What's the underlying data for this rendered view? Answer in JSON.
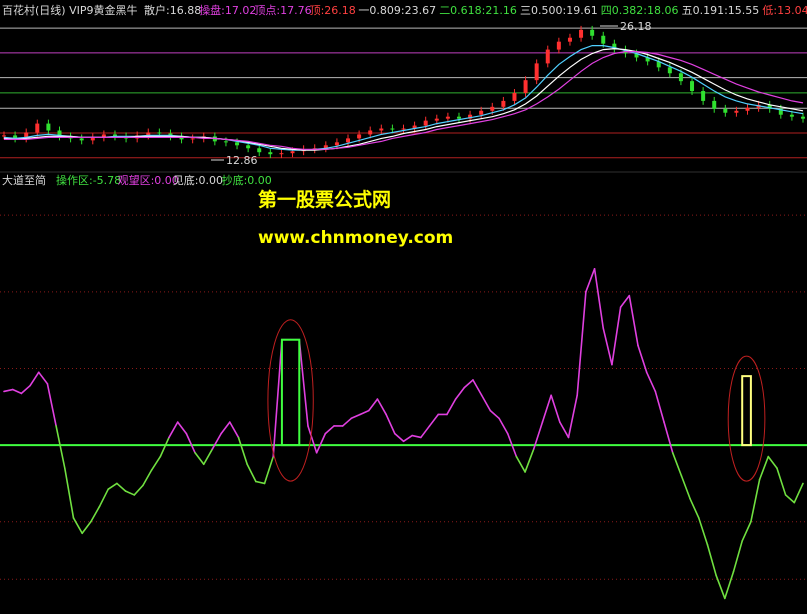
{
  "colors": {
    "background": "#000000",
    "label_white": "#d8d8d8",
    "label_magenta": "#e040e0",
    "label_red": "#ff4040",
    "label_green": "#40e040",
    "label_yellow": "#ffff40",
    "level_line_white": "#b8b8b8",
    "level_line_magenta": "#c040c0",
    "level_line_red": "#b02020",
    "level_line_green": "#30b030",
    "osc_positive": "#e040e0",
    "osc_negative": "#70e040",
    "zero_line": "#40ff40",
    "highlight_box_1": "#40ff40",
    "highlight_box_2": "#ffff80",
    "ellipse": "#c02020",
    "watermark": "#ffff00"
  },
  "top_panel": {
    "title": "百花村(日线) VIP9黄金黑牛",
    "stats": [
      {
        "label": "散户:16.88",
        "color": "label_white"
      },
      {
        "label": "操盘:17.02",
        "color": "label_magenta"
      },
      {
        "label": "顶点:17.76",
        "color": "label_magenta"
      },
      {
        "label": "顶:26.18",
        "color": "label_red"
      },
      {
        "label": "一0.809:23.67",
        "color": "label_white"
      },
      {
        "label": "二0.618:21.16",
        "color": "label_green"
      },
      {
        "label": "三0.500:19.61",
        "color": "label_white"
      },
      {
        "label": "四0.382:18.06",
        "color": "label_green"
      },
      {
        "label": "五0.191:15.55",
        "color": "label_white"
      },
      {
        "label": "低:13.04",
        "color": "label_red"
      }
    ],
    "peak_marker": "26.18",
    "low_marker": "12.86"
  },
  "bottom_panel": {
    "title": "大道至简",
    "stats": [
      {
        "label": "操作区:-5.78",
        "color": "label_green"
      },
      {
        "label": "观望区:0.00",
        "color": "label_magenta"
      },
      {
        "label": "见底:0.00",
        "color": "label_white"
      },
      {
        "label": "抄底:0.00",
        "color": "label_green"
      }
    ]
  },
  "watermark": {
    "line1": "第一股票公式网",
    "line2": "www.chnmoney.com"
  },
  "chart_data": [
    {
      "type": "line",
      "name": "price_panel",
      "horizontal_levels": [
        {
          "value": 26.18,
          "color": "level_line_white"
        },
        {
          "value": 23.67,
          "color": "level_line_magenta"
        },
        {
          "value": 21.16,
          "color": "level_line_white"
        },
        {
          "value": 19.61,
          "color": "level_line_green"
        },
        {
          "value": 18.06,
          "color": "level_line_white"
        },
        {
          "value": 15.55,
          "color": "level_line_red"
        },
        {
          "value": 13.04,
          "color": "level_line_red"
        }
      ],
      "ylim": [
        12.0,
        27.2
      ],
      "price_series": [
        15.3,
        15.0,
        15.6,
        16.5,
        15.8,
        15.2,
        15.0,
        14.8,
        15.1,
        15.4,
        15.2,
        15.0,
        15.3,
        15.6,
        15.5,
        15.2,
        14.9,
        15.0,
        15.2,
        14.7,
        14.6,
        14.3,
        14.0,
        13.6,
        13.4,
        13.5,
        13.7,
        13.9,
        14.0,
        14.3,
        14.6,
        15.0,
        15.4,
        15.8,
        16.0,
        15.9,
        16.0,
        16.3,
        16.8,
        17.0,
        17.2,
        17.0,
        17.4,
        17.8,
        18.2,
        18.8,
        19.6,
        20.9,
        22.6,
        24.0,
        24.8,
        25.2,
        26.0,
        25.4,
        24.6,
        24.0,
        23.6,
        23.2,
        22.8,
        22.2,
        21.6,
        20.8,
        19.8,
        18.8,
        18.0,
        17.6,
        17.8,
        18.1,
        18.4,
        18.0,
        17.4,
        17.2,
        17.0
      ],
      "ma_series": [
        {
          "values": [
            15.1,
            15.0,
            15.1,
            15.3,
            15.4,
            15.3,
            15.2,
            15.1,
            15.1,
            15.1,
            15.2,
            15.2,
            15.2,
            15.3,
            15.3,
            15.3,
            15.2,
            15.1,
            15.1,
            15.0,
            14.9,
            14.7,
            14.5,
            14.3,
            14.0,
            13.9,
            13.8,
            13.8,
            13.9,
            14.0,
            14.2,
            14.5,
            14.8,
            15.1,
            15.4,
            15.6,
            15.8,
            16.0,
            16.2,
            16.5,
            16.7,
            16.9,
            17.1,
            17.3,
            17.6,
            17.9,
            18.4,
            19.1,
            20.2,
            21.4,
            22.5,
            23.3,
            24.0,
            24.4,
            24.4,
            24.2,
            23.9,
            23.6,
            23.2,
            22.8,
            22.3,
            21.8,
            21.2,
            20.5,
            19.8,
            19.2,
            18.8,
            18.5,
            18.3,
            18.1,
            17.9,
            17.7,
            17.5
          ],
          "color": "#50d0ff"
        },
        {
          "values": [
            15.0,
            14.9,
            15.0,
            15.1,
            15.2,
            15.2,
            15.2,
            15.1,
            15.1,
            15.1,
            15.1,
            15.1,
            15.2,
            15.2,
            15.2,
            15.2,
            15.2,
            15.1,
            15.1,
            15.0,
            14.9,
            14.8,
            14.6,
            14.4,
            14.2,
            14.0,
            13.9,
            13.8,
            13.8,
            13.9,
            14.0,
            14.2,
            14.4,
            14.7,
            15.0,
            15.2,
            15.5,
            15.7,
            15.9,
            16.2,
            16.4,
            16.6,
            16.8,
            17.0,
            17.2,
            17.5,
            17.9,
            18.5,
            19.3,
            20.3,
            21.3,
            22.2,
            23.0,
            23.6,
            24.0,
            24.1,
            24.0,
            23.8,
            23.5,
            23.1,
            22.7,
            22.2,
            21.7,
            21.1,
            20.5,
            19.9,
            19.4,
            19.0,
            18.7,
            18.4,
            18.2,
            18.0,
            17.8
          ],
          "color": "#ffffff"
        },
        {
          "values": [
            14.9,
            14.9,
            14.9,
            15.0,
            15.1,
            15.1,
            15.1,
            15.1,
            15.1,
            15.1,
            15.1,
            15.1,
            15.1,
            15.1,
            15.1,
            15.1,
            15.1,
            15.1,
            15.0,
            15.0,
            14.9,
            14.8,
            14.7,
            14.5,
            14.3,
            14.2,
            14.0,
            13.9,
            13.9,
            13.9,
            14.0,
            14.1,
            14.3,
            14.5,
            14.7,
            15.0,
            15.2,
            15.4,
            15.6,
            15.9,
            16.1,
            16.3,
            16.5,
            16.7,
            16.9,
            17.2,
            17.5,
            17.9,
            18.5,
            19.2,
            20.0,
            20.9,
            21.8,
            22.6,
            23.2,
            23.6,
            23.8,
            23.8,
            23.7,
            23.5,
            23.2,
            22.9,
            22.5,
            22.0,
            21.5,
            21.0,
            20.5,
            20.1,
            19.7,
            19.4,
            19.1,
            18.8,
            18.6
          ],
          "color": "#e040e0"
        }
      ]
    },
    {
      "type": "line",
      "name": "oscillator_panel",
      "ylim": [
        -8.5,
        13.0
      ],
      "zero_line": 0,
      "series": [
        2.8,
        2.9,
        2.7,
        3.1,
        3.8,
        3.2,
        1.0,
        -1.2,
        -3.8,
        -4.6,
        -4.0,
        -3.2,
        -2.3,
        -2.0,
        -2.4,
        -2.6,
        -2.1,
        -1.3,
        -0.6,
        0.4,
        1.2,
        0.6,
        -0.4,
        -1.0,
        -0.2,
        0.6,
        1.2,
        0.4,
        -1.0,
        -1.9,
        -2.0,
        -0.6,
        5.5,
        5.5,
        5.5,
        1.0,
        -0.4,
        0.6,
        1.0,
        1.0,
        1.4,
        1.6,
        1.8,
        2.4,
        1.6,
        0.6,
        0.2,
        0.5,
        0.4,
        1.0,
        1.6,
        1.6,
        2.4,
        3.0,
        3.4,
        2.6,
        1.8,
        1.4,
        0.6,
        -0.6,
        -1.4,
        -0.2,
        1.2,
        2.6,
        1.2,
        0.4,
        2.6,
        8.0,
        9.2,
        6.1,
        4.2,
        7.2,
        7.8,
        5.2,
        3.8,
        2.8,
        1.2,
        -0.4,
        -1.6,
        -2.8,
        -3.8,
        -5.2,
        -6.8,
        -8.0,
        -6.6,
        -5.0,
        -4.0,
        -1.8,
        -0.6,
        -1.2,
        -2.6,
        -3.0,
        -2.0
      ],
      "highlight_boxes": [
        {
          "start_index": 32,
          "end_index": 34,
          "value": 5.5,
          "color": "highlight_box_1"
        },
        {
          "start_index": 85,
          "end_index": 86,
          "value": 3.6,
          "color": "highlight_box_2"
        }
      ]
    }
  ]
}
